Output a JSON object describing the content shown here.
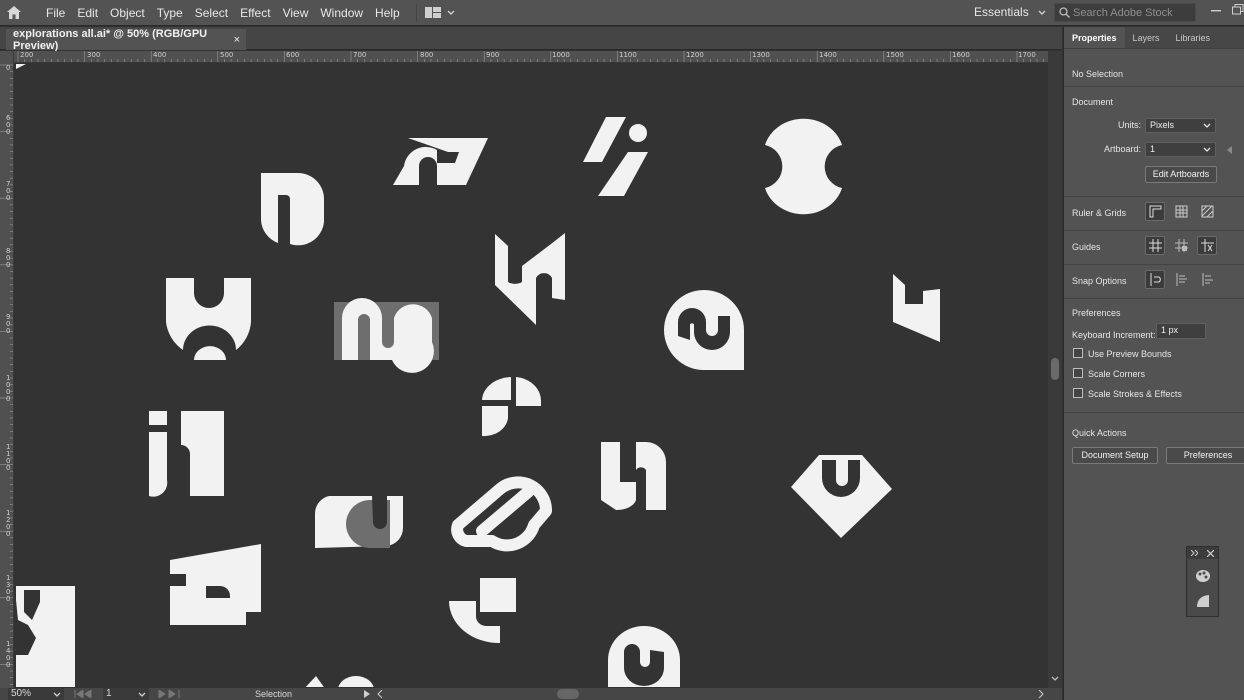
{
  "menubar": {
    "items": [
      "File",
      "Edit",
      "Object",
      "Type",
      "Select",
      "Effect",
      "View",
      "Window",
      "Help"
    ],
    "workspace": "Essentials",
    "search_placeholder": "Search Adobe Stock"
  },
  "document": {
    "tab_title": "explorations all.ai* @ 50% (RGB/GPU Preview)",
    "close_glyph": "×"
  },
  "rulers": {
    "h_labels": [
      "200",
      "300",
      "400",
      "500",
      "600",
      "700",
      "800",
      "900",
      "1000",
      "1100",
      "1200",
      "1300",
      "1400",
      "1500",
      "1600",
      "1700"
    ],
    "v_labels": [
      "0",
      "6 0 0",
      "7 0 0",
      "8 0 0",
      "9 0 0",
      "1 0 0 0",
      "1 1 0 0",
      "1 2 0 0",
      "1 3 0 0",
      "1 4 0 0"
    ]
  },
  "status": {
    "zoom": "50%",
    "artboard_num": "1",
    "tool": "Selection"
  },
  "panel": {
    "tabs": [
      "Properties",
      "Layers",
      "Libraries"
    ],
    "no_selection": "No Selection",
    "document_label": "Document",
    "units_label": "Units:",
    "units_value": "Pixels",
    "artboard_label": "Artboard:",
    "artboard_value": "1",
    "edit_artboards": "Edit Artboards",
    "ruler_grids": "Ruler & Grids",
    "guides": "Guides",
    "snap_options": "Snap Options",
    "preferences_label": "Preferences",
    "keyboard_increment_label": "Keyboard Increment:",
    "keyboard_increment_value": "1 px",
    "use_preview_bounds": "Use Preview Bounds",
    "scale_corners": "Scale Corners",
    "scale_strokes": "Scale Strokes & Effects",
    "quick_actions": "Quick Actions",
    "document_setup": "Document Setup",
    "preferences_button": "Preferences"
  },
  "colors": {
    "canvas": "#333333",
    "shape_white": "#f2f2f2",
    "shape_gray": "#6e6e6e",
    "panel": "#535353"
  }
}
